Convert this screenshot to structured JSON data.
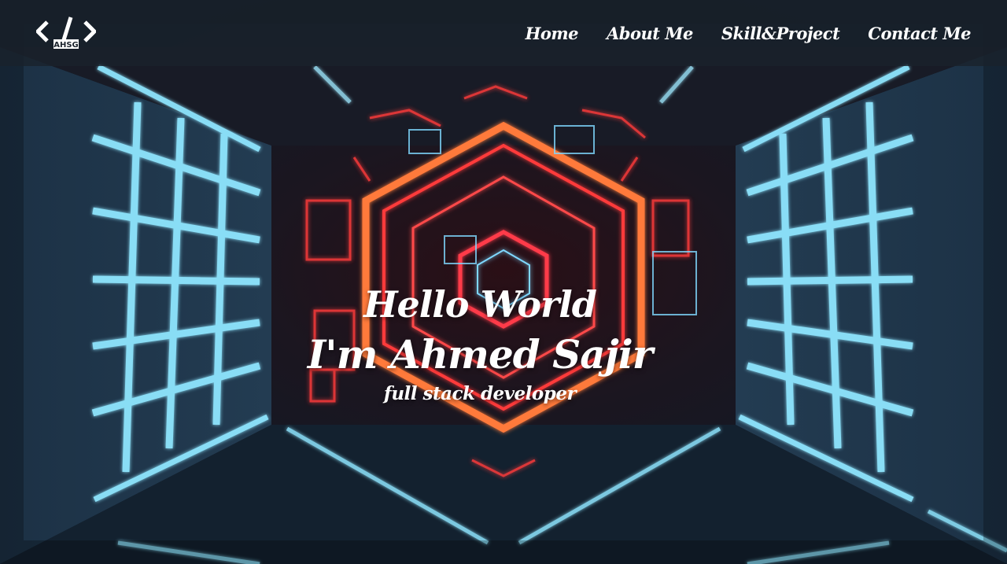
{
  "logo": {
    "text": "AHSG",
    "icon": "code-brackets-icon"
  },
  "nav": {
    "items": [
      {
        "label": "Home"
      },
      {
        "label": "About Me"
      },
      {
        "label": "Skill&Project"
      },
      {
        "label": "Contact Me"
      }
    ]
  },
  "hero": {
    "greeting": "Hello World",
    "name": "I'm Ahmed Sajir",
    "role": "full stack developer"
  },
  "colors": {
    "navbar_bg": "#1a222c",
    "neon_red": "#ff3b3b",
    "neon_orange": "#ff8a3d",
    "neon_cyan": "#7fe0ff",
    "text": "#ffffff"
  }
}
